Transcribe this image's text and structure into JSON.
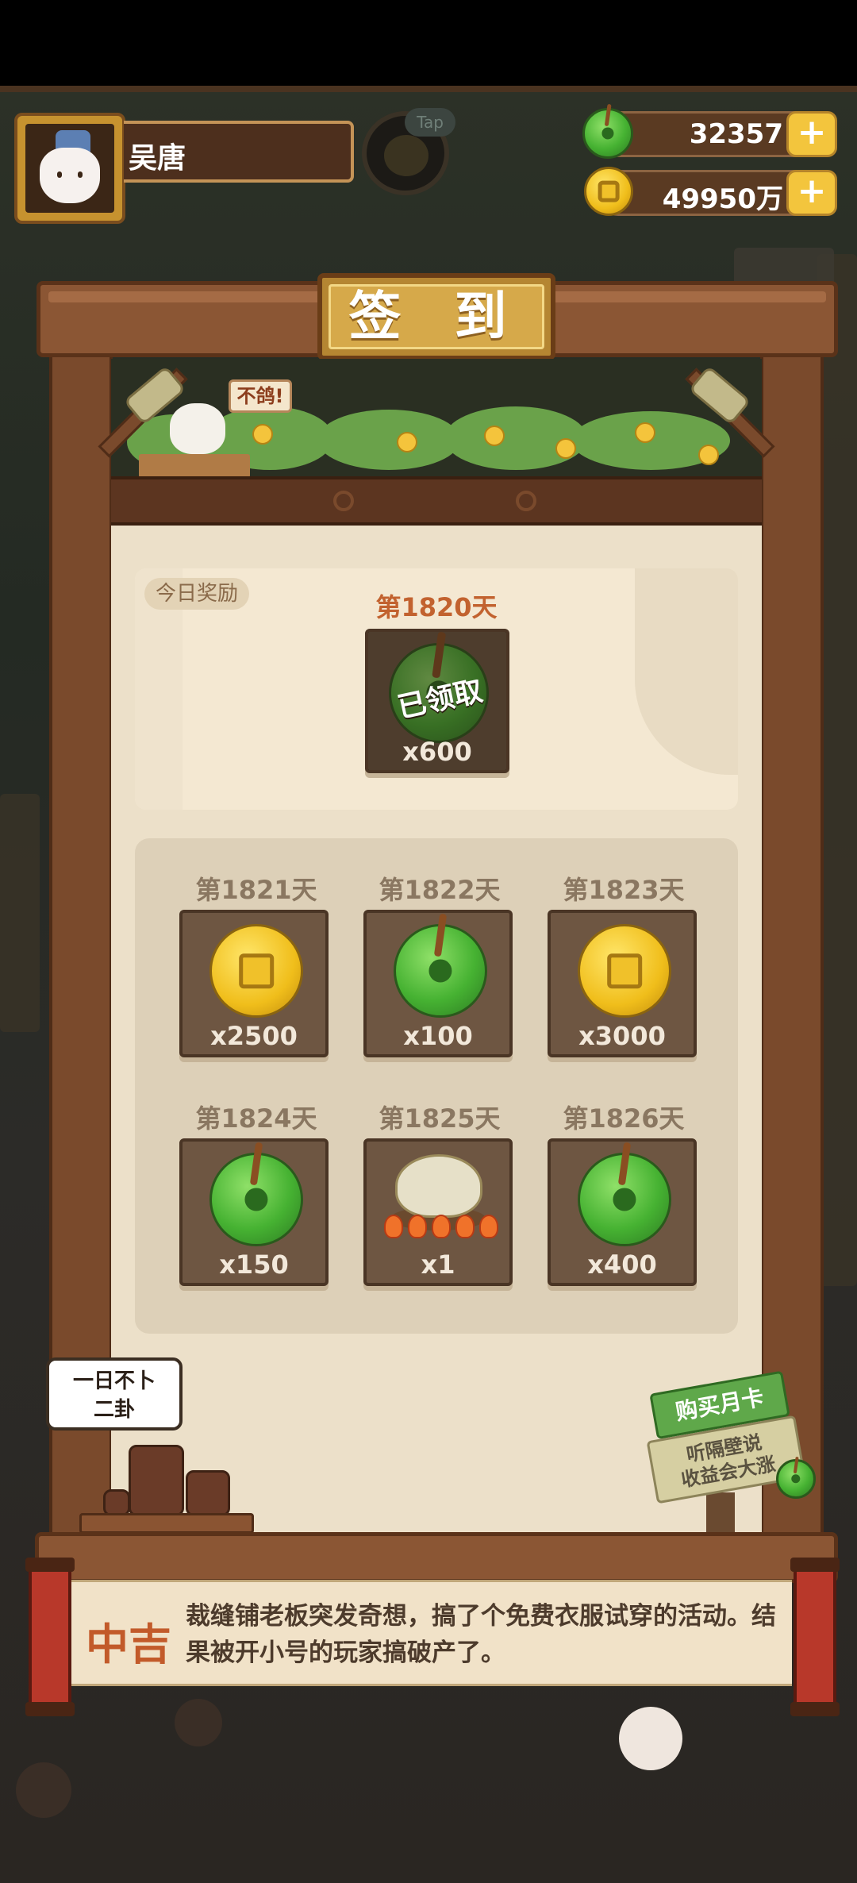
{
  "player": {
    "name": "吴唐",
    "avatar_icon": "cat-avatar-icon"
  },
  "tap_hint": "Tap",
  "resources": {
    "jade": {
      "icon": "jade-icon",
      "value": "32357",
      "add_label": "+"
    },
    "coin": {
      "icon": "coin-icon",
      "value": "49950万",
      "add_label": "+"
    }
  },
  "signin": {
    "title": "签 到",
    "mascot_speech": "不鸽!",
    "today_tag": "今日奖励",
    "today": {
      "day": "第1820天",
      "reward_icon": "jade-icon",
      "qty": "x600",
      "status": "已领取"
    },
    "upcoming": [
      {
        "day": "第1821天",
        "reward_icon": "coin-icon",
        "qty": "x2500"
      },
      {
        "day": "第1822天",
        "reward_icon": "jade-icon",
        "qty": "x100"
      },
      {
        "day": "第1823天",
        "reward_icon": "coin-icon",
        "qty": "x3000"
      },
      {
        "day": "第1824天",
        "reward_icon": "jade-icon",
        "qty": "x150"
      },
      {
        "day": "第1825天",
        "reward_icon": "cake-icon",
        "qty": "x1"
      },
      {
        "day": "第1826天",
        "reward_icon": "jade-icon",
        "qty": "x400"
      }
    ]
  },
  "divination_bubble": {
    "line1": "一日不卜",
    "line2": "二卦"
  },
  "month_card": {
    "button_label": "购买月卡",
    "subtext_line1": "听隔壁说",
    "subtext_line2": "收益会大涨"
  },
  "fortune": {
    "level": "中吉",
    "text": "裁缝铺老板突发奇想，搞了个免费衣服试穿的活动。结果被开小号的玩家搞破产了。"
  },
  "colors": {
    "wood": "#8b5634",
    "parchment": "#ece0c9",
    "today_day": "#c2622f",
    "fortune_red": "#c25a2a",
    "jade_green": "#46b232",
    "coin_gold": "#f0be1b"
  }
}
